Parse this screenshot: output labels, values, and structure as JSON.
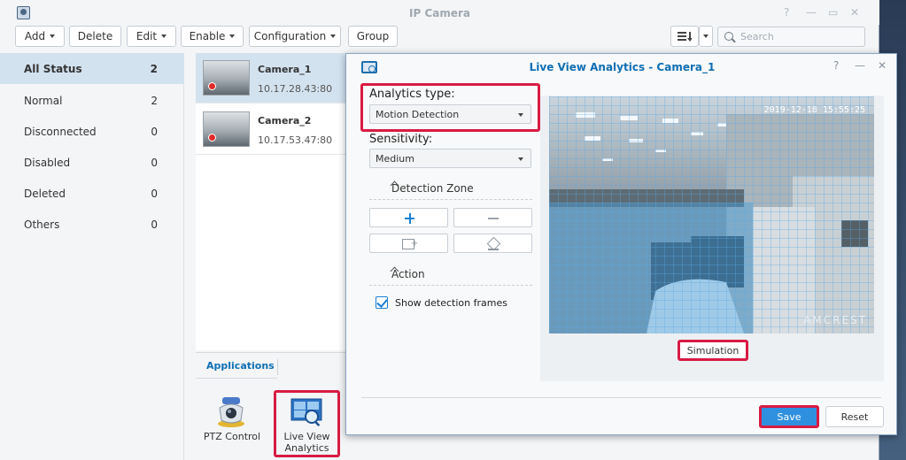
{
  "window": {
    "title": "IP Camera",
    "controls": [
      "?",
      "—",
      "▭",
      "✕"
    ]
  },
  "toolbar": {
    "add": "Add",
    "delete": "Delete",
    "edit": "Edit",
    "enable": "Enable",
    "configuration": "Configuration",
    "group": "Group",
    "search_placeholder": "Search"
  },
  "sidebar": {
    "items": [
      {
        "label": "All Status",
        "count": "2"
      },
      {
        "label": "Normal",
        "count": "2"
      },
      {
        "label": "Disconnected",
        "count": "0"
      },
      {
        "label": "Disabled",
        "count": "0"
      },
      {
        "label": "Deleted",
        "count": "0"
      },
      {
        "label": "Others",
        "count": "0"
      }
    ]
  },
  "cameras": [
    {
      "name": "Camera_1",
      "ip": "10.17.28.43:80"
    },
    {
      "name": "Camera_2",
      "ip": "10.17.53.47:80"
    }
  ],
  "applications": {
    "tab": "Applications",
    "ptz_label": "PTZ Control",
    "lva_label_1": "Live View",
    "lva_label_2": "Analytics"
  },
  "dialog": {
    "title": "Live View Analytics - Camera_1",
    "controls": [
      "?",
      "—",
      "✕"
    ],
    "analytics_type_label": "Analytics type:",
    "analytics_type_value": "Motion Detection",
    "sensitivity_label": "Sensitivity:",
    "sensitivity_value": "Medium",
    "detection_zone": "Detection Zone",
    "action": "Action",
    "show_frames": "Show detection frames",
    "timestamp": "2019-12-18 15:55:25",
    "brand": "AMCREST",
    "simulation": "Simulation",
    "save": "Save",
    "reset": "Reset"
  },
  "colors": {
    "highlight": "#d81b43",
    "accent": "#0f6fb3",
    "primary_button": "#2f90e0"
  }
}
